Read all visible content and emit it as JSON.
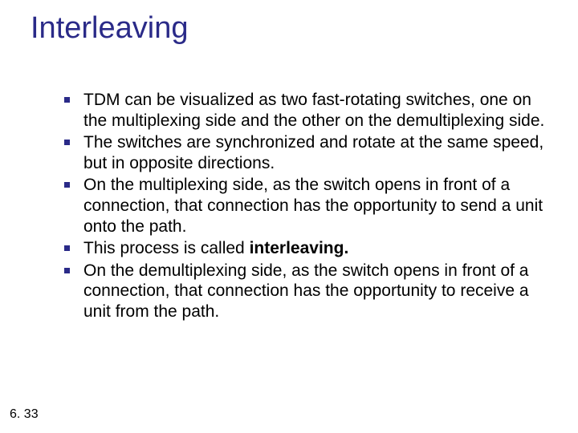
{
  "slide": {
    "title": "Interleaving",
    "footer": "6. 33",
    "bullets": [
      {
        "text": "TDM can be visualized as two fast-rotating switches, one on the multiplexing side and the other on the demultiplexing side."
      },
      {
        "text": "The switches are synchronized and rotate at the same speed, but in opposite directions."
      },
      {
        "text": "On the multiplexing side, as the switch opens in front of a connection, that connection has the opportunity to send a unit onto the path."
      },
      {
        "prefix": "This process is called ",
        "bold": "interleaving."
      },
      {
        "text": "On the demultiplexing side, as the switch opens in front of a connection, that connection has the opportunity to receive a unit from the path."
      }
    ]
  }
}
